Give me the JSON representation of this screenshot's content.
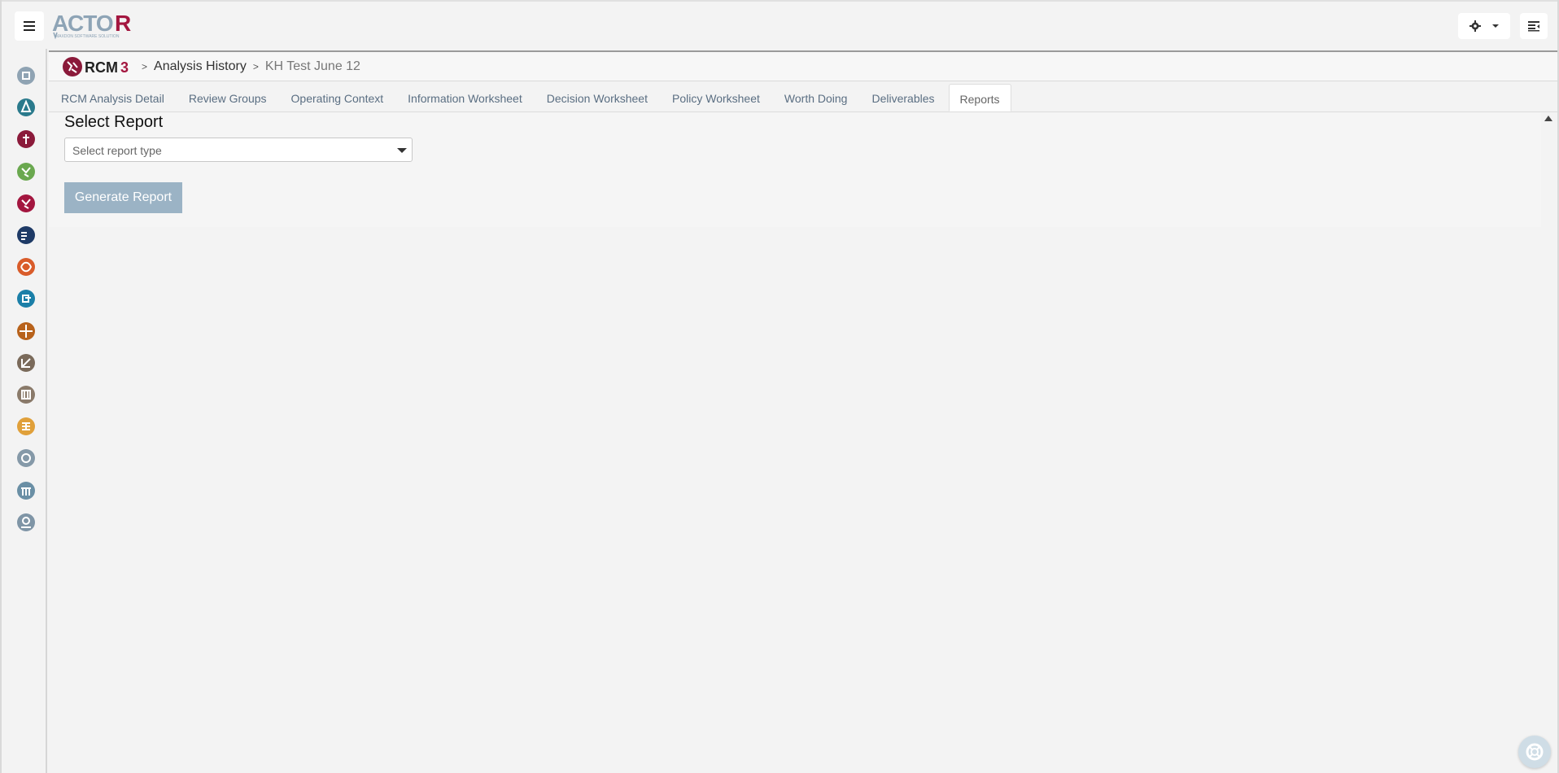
{
  "app": {
    "logo_text": "ACTOR",
    "logo_tagline": "MAXDON SOFTWARE SOLUTION"
  },
  "header": {
    "menu_icon": "hamburger-icon",
    "settings_icon": "gear-icon",
    "panel_icon": "sidebar-toggle-icon"
  },
  "sidebar": {
    "items": [
      {
        "icon": "module-icon-1",
        "color": "#8fa3b3"
      },
      {
        "icon": "module-icon-2",
        "color": "#2a7a8c"
      },
      {
        "icon": "module-icon-3",
        "color": "#8b1a3a"
      },
      {
        "icon": "module-icon-4",
        "color": "#6aa84f"
      },
      {
        "icon": "module-icon-5",
        "color": "#a3163f"
      },
      {
        "icon": "module-icon-6",
        "color": "#1e3a66"
      },
      {
        "icon": "module-icon-7",
        "color": "#d95c2a"
      },
      {
        "icon": "module-icon-8",
        "color": "#1b7fa8"
      },
      {
        "icon": "module-icon-9",
        "color": "#b8621b"
      },
      {
        "icon": "module-icon-10",
        "color": "#7a6a5a"
      },
      {
        "icon": "module-icon-11",
        "color": "#8a7a6a"
      },
      {
        "icon": "module-icon-12",
        "color": "#e0a03a"
      },
      {
        "icon": "module-icon-13",
        "color": "#8599a8"
      },
      {
        "icon": "module-icon-14",
        "color": "#6a8fa5"
      },
      {
        "icon": "module-icon-15",
        "color": "#7f95a6"
      }
    ]
  },
  "breadcrumb": {
    "module_logo_text": "RCM3",
    "separator": ">",
    "items": [
      "Analysis History",
      "KH Test June 12"
    ]
  },
  "tabs": [
    {
      "label": "RCM Analysis Detail",
      "active": false
    },
    {
      "label": "Review Groups",
      "active": false
    },
    {
      "label": "Operating Context",
      "active": false
    },
    {
      "label": "Information Worksheet",
      "active": false
    },
    {
      "label": "Decision Worksheet",
      "active": false
    },
    {
      "label": "Policy Worksheet",
      "active": false
    },
    {
      "label": "Worth Doing",
      "active": false
    },
    {
      "label": "Deliverables",
      "active": false
    },
    {
      "label": "Reports",
      "active": true
    }
  ],
  "report": {
    "title": "Select Report",
    "select_placeholder": "Select report type",
    "generate_label": "Generate Report"
  },
  "colors": {
    "generate_button": "#9bb3c5",
    "tab_text": "#5a6e82",
    "brand_red": "#8b1a3a"
  }
}
